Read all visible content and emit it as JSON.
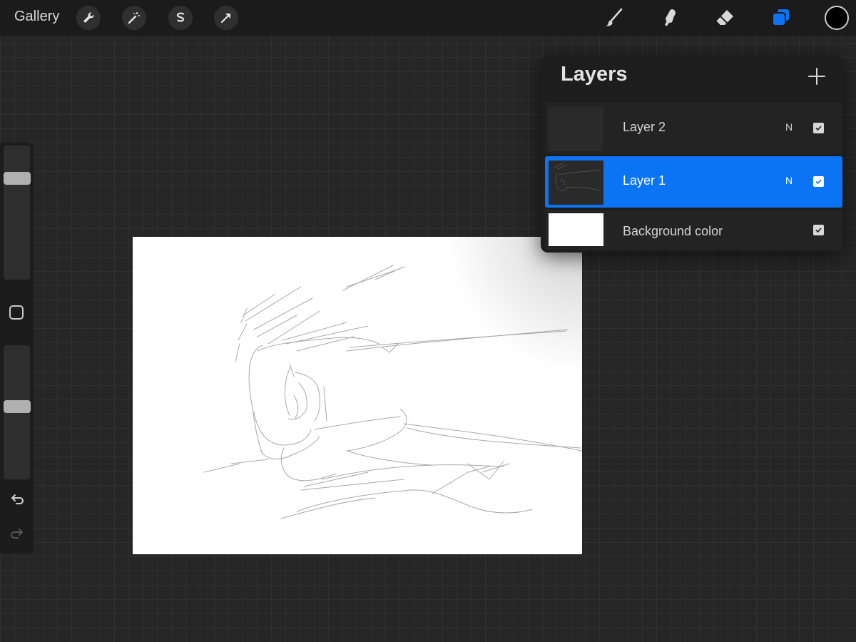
{
  "topbar": {
    "gallery_label": "Gallery",
    "left_tools": [
      "wrench-icon",
      "magic-wand-icon",
      "selection-icon",
      "transform-arrow-icon"
    ],
    "right_tools": [
      "brush-icon",
      "smudge-icon",
      "eraser-icon",
      "layers-icon"
    ],
    "active_tool": "layers-icon",
    "current_color": "#000000"
  },
  "sidebar": {
    "brush_size_level": 0.78,
    "opacity_level": 0.55,
    "icons": [
      "modify-square-icon",
      "undo-icon",
      "redo-icon"
    ]
  },
  "layers_panel": {
    "title": "Layers",
    "add_icon": "plus-icon",
    "layers": [
      {
        "name": "Layer 2",
        "blend": "N",
        "visible": true,
        "selected": false
      },
      {
        "name": "Layer 1",
        "blend": "N",
        "visible": true,
        "selected": true
      },
      {
        "name": "Background color",
        "blend": "",
        "visible": true,
        "selected": false
      }
    ]
  },
  "colors": {
    "accent": "#0a74f5",
    "panel": "#1d1d1d",
    "background": "#262626"
  }
}
